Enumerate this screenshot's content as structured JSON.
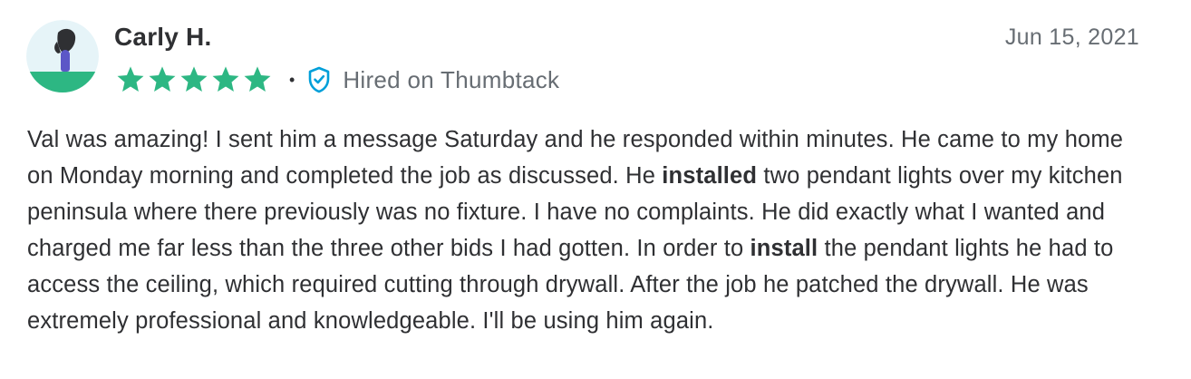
{
  "reviewer": {
    "name": "Carly H.",
    "avatar_icon": "user-avatar-illustration"
  },
  "date": "Jun 15, 2021",
  "rating": {
    "stars": 5,
    "max": 5,
    "star_color": "#2db783",
    "separator": "•"
  },
  "badge": {
    "icon": "shield-check-icon",
    "label": "Hired on Thumbtack",
    "color": "#009fd9"
  },
  "review": {
    "segments": [
      {
        "text": "Val was amazing! I sent him a message Saturday and he responded within minutes. He came to my home on Monday morning and completed the job as discussed. He ",
        "bold": false
      },
      {
        "text": "installed",
        "bold": true
      },
      {
        "text": " two pendant lights over my kitchen peninsula where there previously was no fixture. I have no complaints. He did exactly what I wanted and charged me far less than the three other bids I had gotten. In order to ",
        "bold": false
      },
      {
        "text": "install",
        "bold": true
      },
      {
        "text": " the pendant lights he had to access the ceiling, which required cutting through drywall. After the job he patched the drywall. He was extremely professional and knowledgeable. I'll be using him again.",
        "bold": false
      }
    ]
  }
}
